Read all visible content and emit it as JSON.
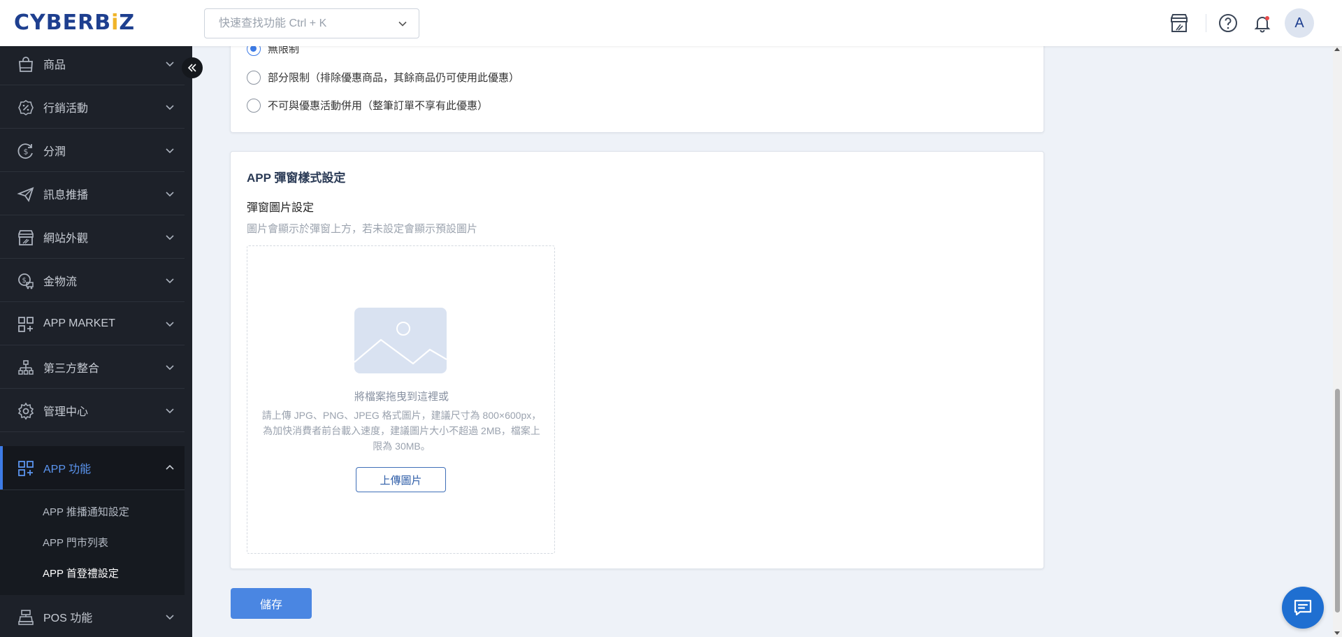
{
  "header": {
    "logo_text": "CYBERB",
    "logo_accent": "i",
    "logo_suffix": "Z",
    "search_placeholder": "快速查找功能 Ctrl + K",
    "avatar_letter": "A"
  },
  "sidebar": {
    "items": [
      {
        "label": "商品",
        "icon": "shopping-bag-icon"
      },
      {
        "label": "行銷活動",
        "icon": "discount-icon"
      },
      {
        "label": "分潤",
        "icon": "dollar-cycle-icon"
      },
      {
        "label": "訊息推播",
        "icon": "paper-plane-icon"
      },
      {
        "label": "網站外觀",
        "icon": "storefront-icon"
      },
      {
        "label": "金物流",
        "icon": "logistics-icon"
      },
      {
        "label": "APP MARKET",
        "icon": "app-grid-plus-icon"
      },
      {
        "label": "第三方整合",
        "icon": "integration-icon"
      },
      {
        "label": "管理中心",
        "icon": "gear-icon"
      },
      {
        "label": "APP 功能",
        "icon": "app-grid-plus-icon"
      },
      {
        "label": "POS 功能",
        "icon": "cash-register-icon"
      }
    ],
    "sub_items": [
      "APP 推播通知設定",
      "APP 門市列表",
      "APP 首登禮設定"
    ]
  },
  "limit_options": [
    {
      "label": "無限制",
      "checked": true
    },
    {
      "label": "部分限制（排除優惠商品，其餘商品仍可使用此優惠）",
      "checked": false
    },
    {
      "label": "不可與優惠活動併用（整筆訂單不享有此優惠）",
      "checked": false
    }
  ],
  "popup_card": {
    "title": "APP 彈窗樣式設定",
    "field_label": "彈窗圖片設定",
    "field_hint": "圖片會顯示於彈窗上方，若未設定會顯示預設圖片",
    "drop_title": "將檔案拖曳到這裡或",
    "drop_desc": "請上傳 JPG、PNG、JPEG 格式圖片，建議尺寸為 800×600px，為加快消費者前台載入速度，建議圖片大小不超過 2MB，檔案上限為 30MB。",
    "upload_label": "上傳圖片"
  },
  "save_label": "儲存",
  "colors": {
    "accent": "#3d7be6",
    "sidebar_bg": "#1d2129",
    "brand": "#1e3f8f"
  }
}
